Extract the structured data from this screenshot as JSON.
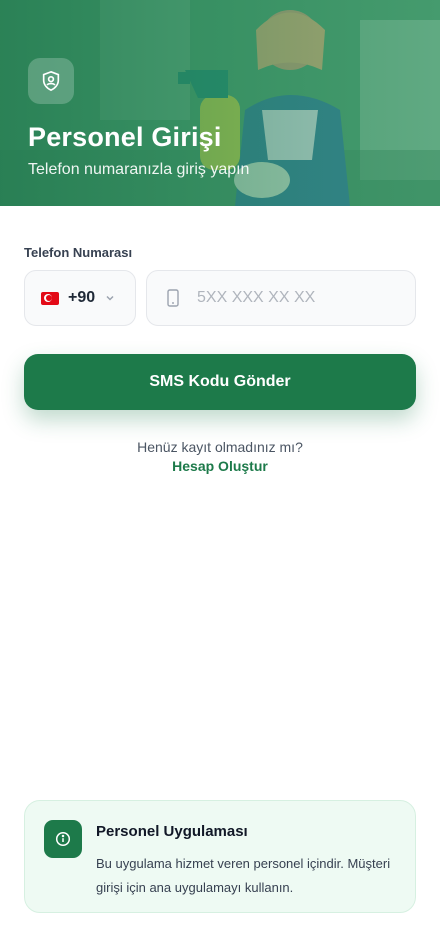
{
  "header": {
    "title": "Personel Girişi",
    "subtitle": "Telefon numaranızla giriş yapın",
    "badge_icon": "user-shield-icon"
  },
  "form": {
    "phone_label": "Telefon Numarası",
    "country": {
      "flag": "turkey-flag-icon",
      "dial_code": "+90"
    },
    "phone_placeholder": "5XX XXX XX XX",
    "phone_value": ""
  },
  "actions": {
    "send_sms_label": "SMS Kodu Gönder",
    "no_account_text": "Henüz kayıt olmadınız mı?",
    "create_account_label": "Hesap Oluştur"
  },
  "info": {
    "title": "Personel Uygulaması",
    "text": "Bu uygulama hizmet veren personel içindir. Müşteri girişi için ana uygulamayı kullanın.",
    "icon": "info-icon"
  },
  "colors": {
    "primary": "#1d7a4a",
    "info_background": "#eefaf3"
  }
}
